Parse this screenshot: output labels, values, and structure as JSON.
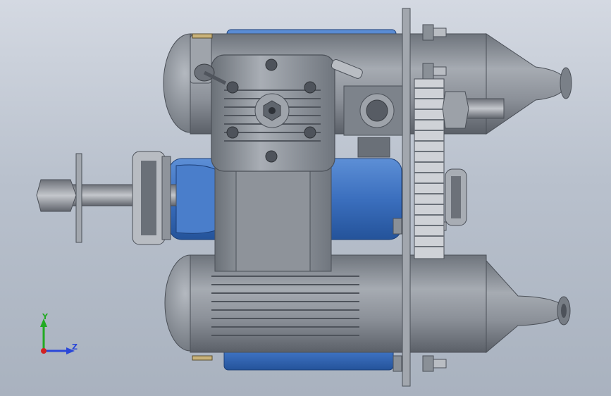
{
  "viewport": {
    "background_top": "#d4d9e2",
    "background_bottom": "#a9b2bf"
  },
  "model": {
    "colors": {
      "steel": "#8e949c",
      "steel_light": "#c7cbd1",
      "steel_dark": "#5d636b",
      "blue": "#3e74c4",
      "blue_dark": "#23549a",
      "gear": "#d8dade"
    }
  },
  "triad": {
    "y_label": "Y",
    "z_label": "Z",
    "y_color": "#22aa22",
    "z_color": "#2a47d8",
    "origin_color": "#d22222"
  }
}
